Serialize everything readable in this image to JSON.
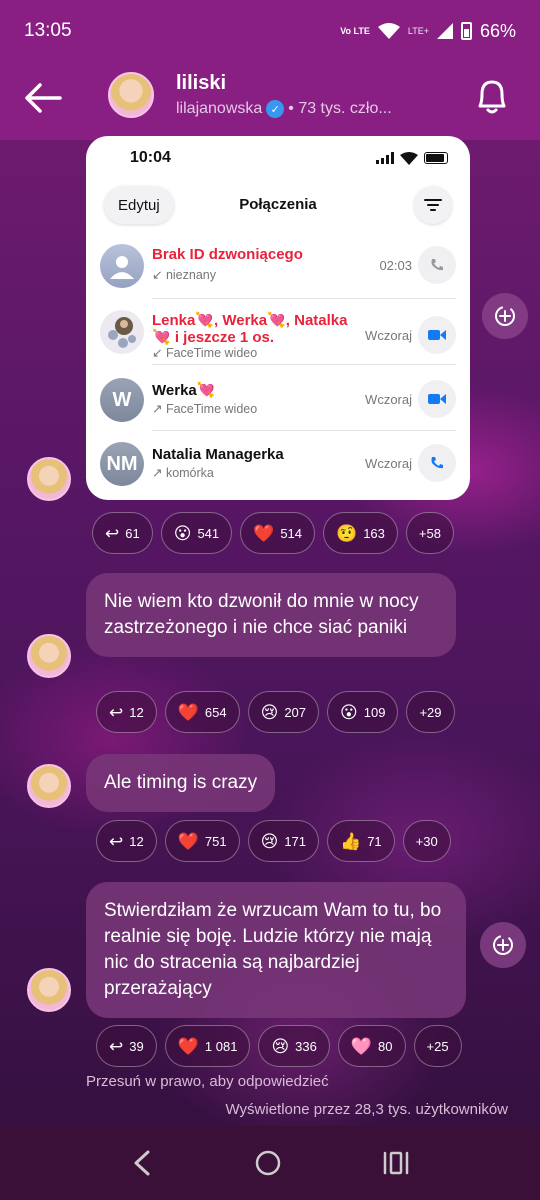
{
  "status_bar": {
    "time": "13:05",
    "volte": "Vo LTE",
    "lte": "LTE+",
    "battery": "66%"
  },
  "header": {
    "title": "liliski",
    "handle": "lilajanowska",
    "subtitle": "• 73 tys. czło..."
  },
  "screenshot": {
    "time": "10:04",
    "edit_label": "Edytuj",
    "title": "Połączenia",
    "calls": [
      {
        "name": "Brak ID dzwoniącego",
        "detail": "↙ nieznany",
        "time": "02:03",
        "missed": true,
        "type": "phone"
      },
      {
        "name": "Lenka💘, Werka💘, Natalka 💘 i jeszcze 1 os.",
        "detail": "↙ FaceTime wideo",
        "time": "Wczoraj",
        "missed": true,
        "type": "video"
      },
      {
        "name": "Werka💘",
        "detail": "↗ FaceTime wideo",
        "time": "Wczoraj",
        "missed": false,
        "type": "video",
        "initials": "W"
      },
      {
        "name": "Natalia Managerka",
        "detail": "↗ komórka",
        "time": "Wczoraj",
        "missed": false,
        "type": "phone",
        "initials": "NM"
      }
    ]
  },
  "messages": [
    {
      "text": "",
      "reactions": [
        {
          "emoji": "↩",
          "count": "61"
        },
        {
          "emoji": "😮",
          "count": "541"
        },
        {
          "emoji": "❤️",
          "count": "514"
        },
        {
          "emoji": "🤨",
          "count": "163"
        },
        {
          "emoji": "",
          "count": "+58"
        }
      ]
    },
    {
      "text": "Nie wiem kto dzwonił do mnie w nocy zastrzeżonego i nie chce siać paniki",
      "reactions": [
        {
          "emoji": "↩",
          "count": "12"
        },
        {
          "emoji": "❤️",
          "count": "654"
        },
        {
          "emoji": "😢",
          "count": "207"
        },
        {
          "emoji": "😮",
          "count": "109"
        },
        {
          "emoji": "",
          "count": "+29"
        }
      ]
    },
    {
      "text": "Ale timing is crazy",
      "reactions": [
        {
          "emoji": "↩",
          "count": "12"
        },
        {
          "emoji": "❤️",
          "count": "751"
        },
        {
          "emoji": "😢",
          "count": "171"
        },
        {
          "emoji": "👍",
          "count": "71"
        },
        {
          "emoji": "",
          "count": "+30"
        }
      ]
    },
    {
      "text": "Stwierdziłam że wrzucam Wam to tu, bo realnie się boję. Ludzie którzy nie mają nic do stracenia są najbardziej przerażający",
      "reactions": [
        {
          "emoji": "↩",
          "count": "39"
        },
        {
          "emoji": "❤️",
          "count": "1 081"
        },
        {
          "emoji": "😢",
          "count": "336"
        },
        {
          "emoji": "🩷",
          "count": "80"
        },
        {
          "emoji": "",
          "count": "+25"
        }
      ]
    }
  ],
  "footer": {
    "hint": "Przesuń w prawo, aby odpowiedzieć",
    "views": "Wyświetlone przez 28,3 tys. użytkowników"
  },
  "colors": {
    "header": "#8a1f83",
    "bubble": "#78377a",
    "missed": "#e7243c"
  }
}
